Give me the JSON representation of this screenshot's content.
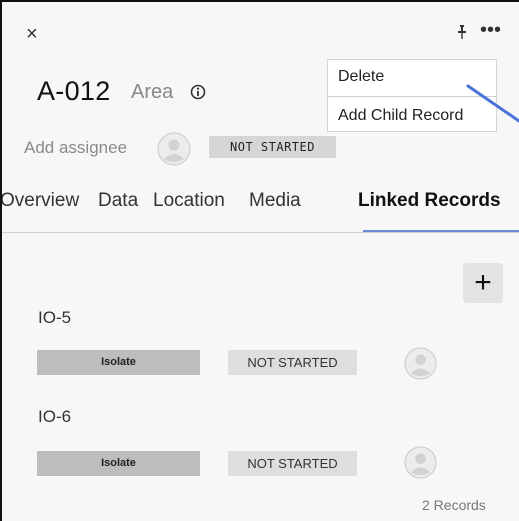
{
  "header": {
    "close_label": "×",
    "more_label": "•••",
    "title": "A-012",
    "subtitle": "Area"
  },
  "assignee": {
    "label": "Add assignee",
    "status": "NOT STARTED"
  },
  "tabs": [
    {
      "label": "Overview",
      "active": false
    },
    {
      "label": "Data",
      "active": false
    },
    {
      "label": "Location",
      "active": false
    },
    {
      "label": "Media",
      "active": false
    },
    {
      "label": "Linked Records",
      "active": true
    }
  ],
  "add_button_label": "+",
  "records": [
    {
      "name": "IO-5",
      "type": "Isolate",
      "status": "NOT STARTED"
    },
    {
      "name": "IO-6",
      "type": "Isolate",
      "status": "NOT STARTED"
    }
  ],
  "records_count": "2 Records",
  "menu": {
    "items": [
      "Delete",
      "Add Child Record"
    ]
  },
  "colors": {
    "accent": "#6b8ad6",
    "cursor_line": "#4a73d8"
  }
}
